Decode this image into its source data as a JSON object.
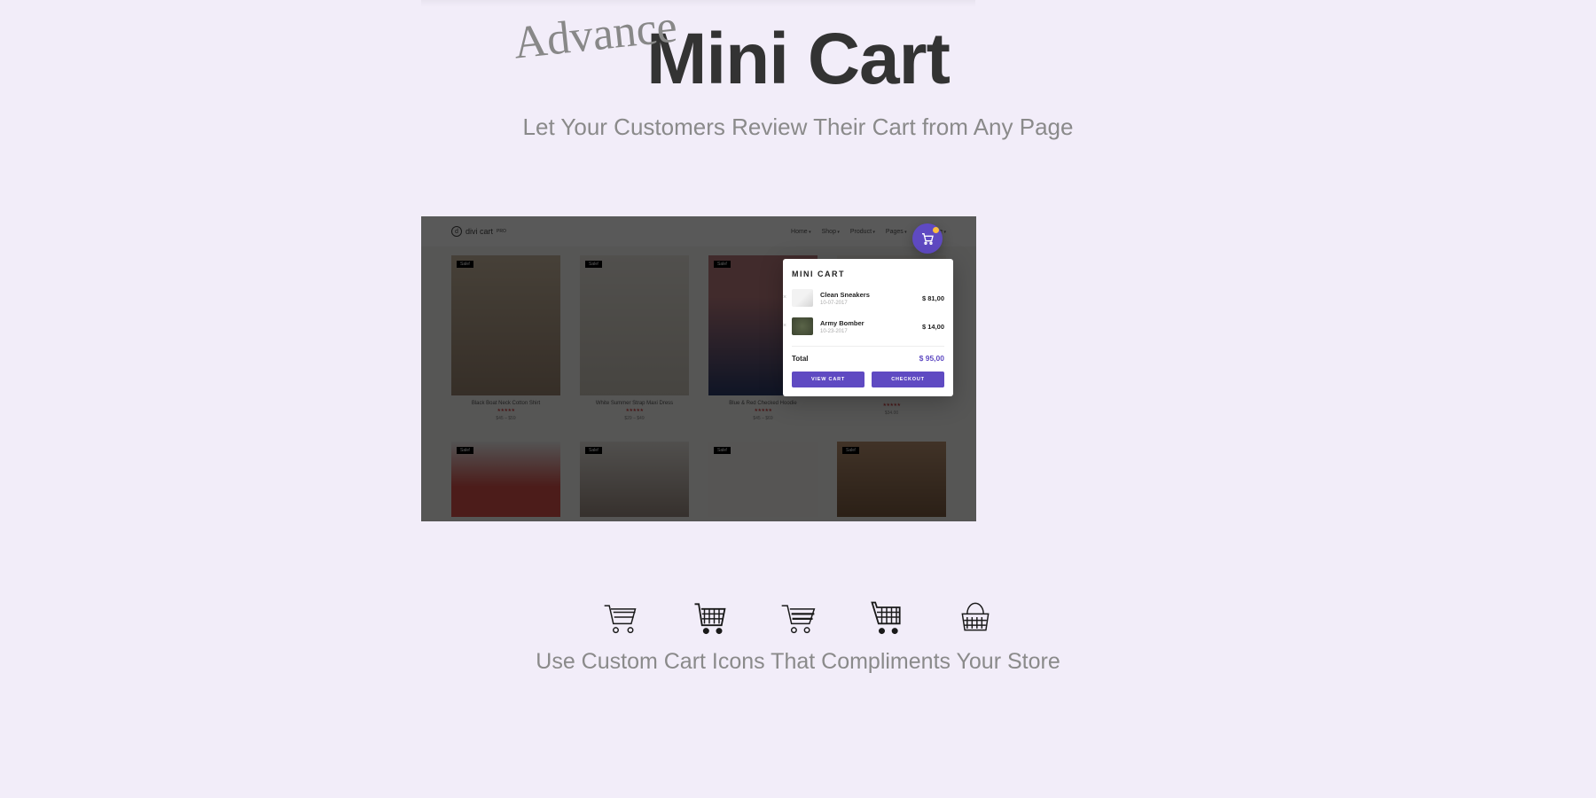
{
  "header": {
    "prefix": "Advance",
    "title": "Mini Cart",
    "subtitle": "Let Your Customers Review Their Cart from Any Page"
  },
  "mock": {
    "logo": "divi cart",
    "logo_suffix": "PRO",
    "nav": [
      "Home",
      "Shop",
      "Product",
      "Pages",
      "Template"
    ],
    "products": [
      {
        "badge": "Sale!",
        "title": "Black Boat Neck Cotton Shirt",
        "price": "$45 – $59"
      },
      {
        "badge": "Sale!",
        "title": "White Summer Strap Maxi Dress",
        "price": "$29 – $49"
      },
      {
        "badge": "Sale!",
        "title": "Blue & Red Checked Hoodie",
        "price": "$45 – $69"
      },
      {
        "badge": "Sale!",
        "title": "",
        "price": "$34.00"
      },
      {
        "badge": "Sale!",
        "title": "",
        "price": ""
      },
      {
        "badge": "Sale!",
        "title": "",
        "price": ""
      },
      {
        "badge": "Sale!",
        "title": "",
        "price": ""
      },
      {
        "badge": "Sale!",
        "title": "",
        "price": ""
      }
    ]
  },
  "minicart": {
    "title": "MINI CART",
    "items": [
      {
        "name": "Clean Sneakers",
        "date": "10-07-2017",
        "price": "$ 81,00"
      },
      {
        "name": "Army Bomber",
        "date": "10-23-2017",
        "price": "$ 14,00"
      }
    ],
    "total_label": "Total",
    "total": "$ 95,00",
    "view_cart": "VIEW CART",
    "checkout": "CHECKOUT"
  },
  "bottom": {
    "caption": "Use Custom Cart Icons That Compliments Your Store"
  }
}
